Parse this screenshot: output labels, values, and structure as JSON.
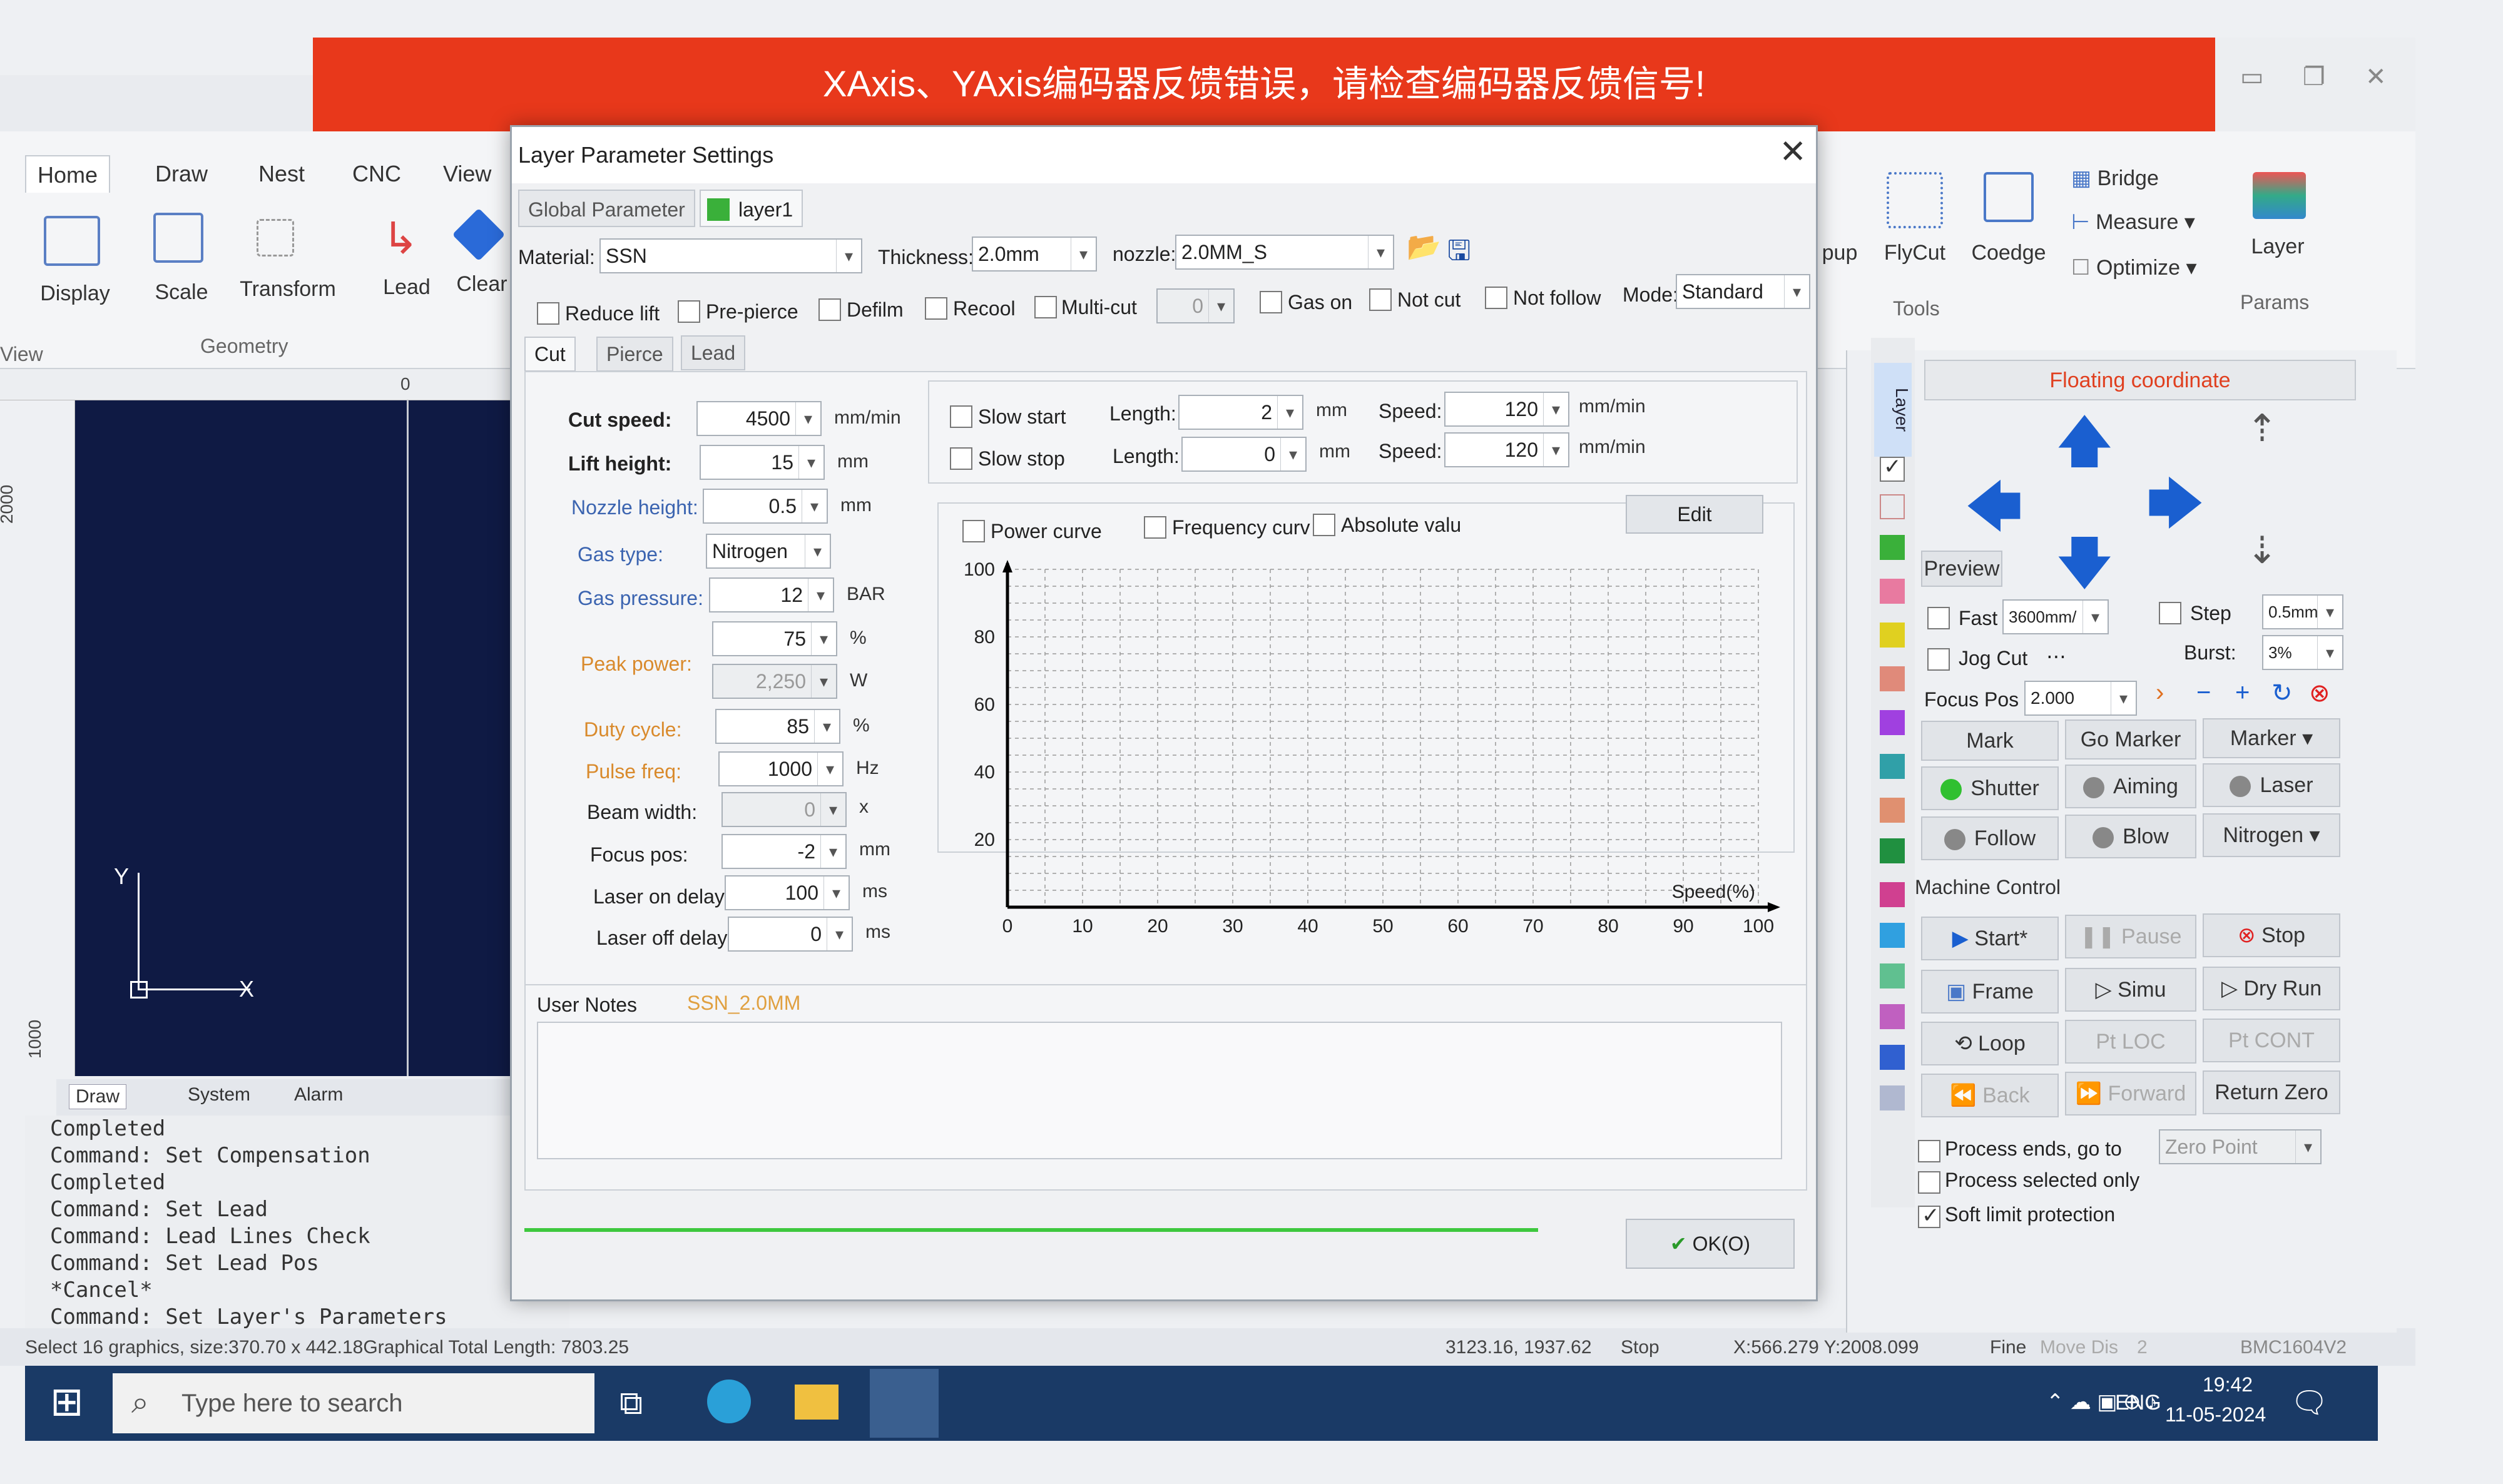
{
  "error_banner": "XAxis、YAxis编码器反馈错误，请检查编码器反馈信号!",
  "ribbon": {
    "tabs": [
      "Home",
      "Draw",
      "Nest",
      "CNC",
      "View"
    ],
    "buttons": {
      "display": "Display",
      "scale": "Scale",
      "transform": "Transform",
      "lead": "Lead",
      "clear": "Clear",
      "flycut": "FlyCut",
      "coedge": "Coedge",
      "bridge": "Bridge",
      "measure": "Measure",
      "optimize": "Optimize",
      "layer": "Layer",
      "pup": "pup"
    },
    "groups": {
      "view": "View",
      "geometry": "Geometry",
      "tools": "Tools",
      "params": "Params"
    }
  },
  "ruler": {
    "zero": "0",
    "v1": "2000",
    "v2": "1000"
  },
  "canvas": {
    "y_axis": "Y",
    "x_axis": "X"
  },
  "log_tabs": [
    "Draw",
    "System",
    "Alarm"
  ],
  "log_lines": [
    "Completed",
    "Command: Set Compensation",
    "Completed",
    "Command: Set Lead",
    "Command: Lead Lines Check",
    "Command: Set Lead Pos",
    "*Cancel*",
    "Command: Set Layer's Parameters"
  ],
  "status": {
    "selection": "Select 16 graphics, size:370.70 x 442.18Graphical Total Length: 7803.25",
    "coords": "3123.16, 1937.62",
    "state": "Stop",
    "position": "X:566.279 Y:2008.099",
    "fine": "Fine",
    "move_dis": "Move Dis",
    "move_val": "2",
    "board": "BMC1604V2"
  },
  "taskbar": {
    "search": "Type here to search",
    "lang": "ENG",
    "time": "19:42",
    "date": "11-05-2024"
  },
  "dialog": {
    "title": "Layer Parameter Settings",
    "tabs": [
      "Global Parameter",
      "layer1"
    ],
    "material_label": "Material:",
    "material": "SSN",
    "thickness_label": "Thickness:",
    "thickness": "2.0mm",
    "nozzle_label": "nozzle:",
    "nozzle": "2.0MM_S",
    "options": [
      "Reduce lift",
      "Pre-pierce",
      "Defilm",
      "Recool",
      "Multi-cut"
    ],
    "multicut_val": "0",
    "options2": [
      "Gas on",
      "Not cut",
      "Not follow"
    ],
    "mode_label": "Mode:",
    "mode": "Standard",
    "subtabs": [
      "Cut",
      "Pierce",
      "Lead"
    ],
    "params": [
      {
        "label": "Cut speed:",
        "value": "4500",
        "unit": "mm/min"
      },
      {
        "label": "Lift height:",
        "value": "15",
        "unit": "mm"
      },
      {
        "label": "Nozzle height:",
        "value": "0.5",
        "unit": "mm"
      },
      {
        "label": "Gas type:",
        "value": "Nitrogen",
        "unit": ""
      },
      {
        "label": "Gas pressure:",
        "value": "12",
        "unit": "BAR"
      },
      {
        "label": "",
        "value": "75",
        "unit": "%"
      },
      {
        "label": "Peak power:",
        "value": "2,250",
        "unit": "W"
      },
      {
        "label": "Duty cycle:",
        "value": "85",
        "unit": "%"
      },
      {
        "label": "Pulse freq:",
        "value": "1000",
        "unit": "Hz"
      },
      {
        "label": "Beam width:",
        "value": "0",
        "unit": "x"
      },
      {
        "label": "Focus pos:",
        "value": "-2",
        "unit": "mm"
      },
      {
        "label": "Laser on delay",
        "value": "100",
        "unit": "ms"
      },
      {
        "label": "Laser off delay",
        "value": "0",
        "unit": "ms"
      }
    ],
    "slow": {
      "start": "Slow start",
      "stop": "Slow stop",
      "length_label": "Length:",
      "len1": "2",
      "len2": "0",
      "mm": "mm",
      "speed_label": "Speed:",
      "sp1": "120",
      "sp2": "120",
      "unit": "mm/min"
    },
    "curve": {
      "power": "Power curve",
      "frequency": "Frequency curv",
      "absolute": "Absolute valu",
      "edit": "Edit"
    },
    "notes_label": "User Notes",
    "notes_name": "SSN_2.0MM",
    "ok": "OK(O)"
  },
  "chart_data": {
    "type": "line",
    "xlabel": "Speed(%)",
    "x_ticks": [
      0,
      10,
      20,
      30,
      40,
      50,
      60,
      70,
      80,
      90,
      100
    ],
    "y_ticks": [
      20,
      40,
      60,
      80,
      100
    ],
    "xlim": [
      0,
      100
    ],
    "ylim": [
      0,
      100
    ],
    "grid": true,
    "series": []
  },
  "right": {
    "floating": "Floating coordinate",
    "preview": "Preview",
    "fast": "Fast",
    "fast_val": "3600mm/",
    "step": "Step",
    "step_val": "0.5mm",
    "jog": "Jog Cut",
    "burst": "Burst:",
    "burst_val": "3%",
    "focus": "Focus Pos",
    "focus_val": "2.000",
    "mark": "Mark",
    "go_marker": "Go Marker",
    "marker": "Marker",
    "shutter": "Shutter",
    "aiming": "Aiming",
    "laser": "Laser",
    "follow": "Follow",
    "blow": "Blow",
    "nitrogen": "Nitrogen",
    "machine": "Machine Control",
    "start": "Start*",
    "pause": "Pause",
    "stop": "Stop",
    "frame": "Frame",
    "simu": "Simu",
    "dryrun": "Dry Run",
    "loop": "Loop",
    "ptloc": "Pt LOC",
    "ptcont": "Pt CONT",
    "back": "Back",
    "forward": "Forward",
    "return_zero": "Return Zero",
    "proc_end": "Process ends, go to",
    "zero_point": "Zero Point",
    "proc_sel": "Process selected only",
    "soft_limit": "Soft limit protection",
    "layer_tab": "Layer"
  },
  "colors": {
    "error": "#e8381b",
    "canvas": "#0f1a44",
    "accent": "#1a5fd0",
    "taskbar": "#1a3a66"
  }
}
